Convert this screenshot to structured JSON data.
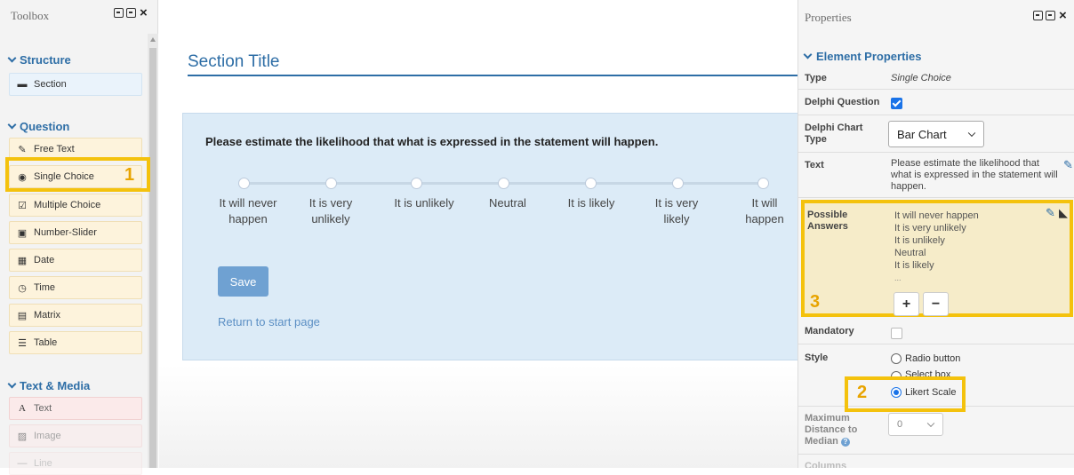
{
  "toolbox": {
    "title": "Toolbox",
    "groups": {
      "structure": "Structure",
      "question": "Question",
      "text_media": "Text & Media"
    },
    "items": {
      "section": "Section",
      "free_text": "Free Text",
      "single_choice": "Single Choice",
      "multiple_choice": "Multiple Choice",
      "number_slider": "Number-Slider",
      "date": "Date",
      "time": "Time",
      "matrix": "Matrix",
      "table": "Table",
      "text": "Text",
      "image": "Image",
      "line": "Line"
    }
  },
  "callouts": {
    "one": "1",
    "two": "2",
    "three": "3"
  },
  "main": {
    "section_title": "Section Title",
    "question": "Please estimate the likelihood that what is expressed in the statement will happen.",
    "options": [
      "It will never happen",
      "It is very unlikely",
      "It is unlikely",
      "Neutral",
      "It is likely",
      "It is very likely",
      "It will happen"
    ],
    "save_label": "Save",
    "return_link": "Return to start page"
  },
  "properties": {
    "title": "Properties",
    "section": "Element Properties",
    "type_label": "Type",
    "type_value": "Single Choice",
    "delphi_question_label": "Delphi Question",
    "delphi_question_checked": true,
    "delphi_chart_type_label": "Delphi Chart Type",
    "delphi_chart_type_value": "Bar Chart",
    "text_label": "Text",
    "text_value": "Please estimate the likelihood that what is expressed in the statement will happen.",
    "possible_answers_label": "Possible Answers",
    "possible_answers": [
      "It will never happen",
      "It is very unlikely",
      "It is unlikely",
      "Neutral",
      "It is likely",
      "..."
    ],
    "add_answer": "+",
    "remove_answer": "−",
    "mandatory_label": "Mandatory",
    "mandatory_checked": false,
    "style_label": "Style",
    "style_options": [
      "Radio button",
      "Select box",
      "Likert Scale"
    ],
    "style_selected": "Likert Scale",
    "max_distance_label": "Maximum Distance to Median",
    "max_distance_value": "0",
    "columns_label": "Columns"
  },
  "colors": {
    "accent": "#2e6ea6",
    "highlight": "#f4c20d",
    "question_bg": "#dcebf7",
    "save_button": "#6fa1d2"
  }
}
